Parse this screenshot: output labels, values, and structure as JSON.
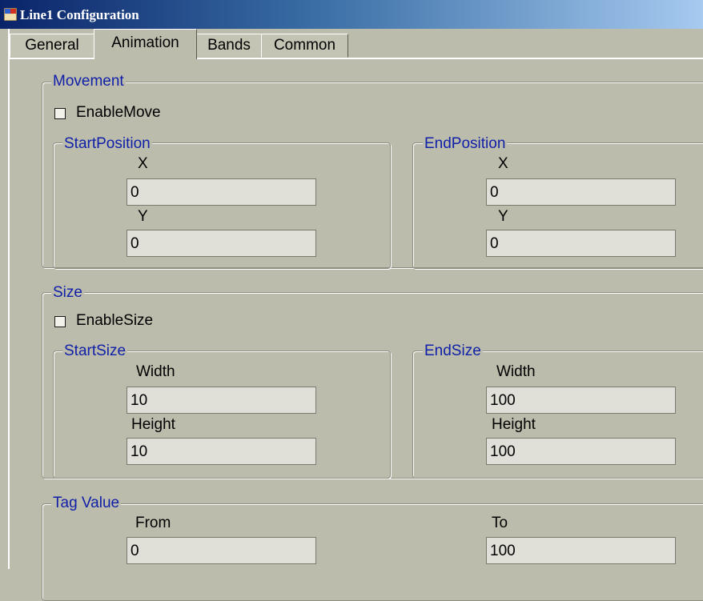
{
  "window": {
    "title": "Line1 Configuration"
  },
  "tabs": [
    {
      "label": "General"
    },
    {
      "label": "Animation"
    },
    {
      "label": "Bands"
    },
    {
      "label": "Common"
    }
  ],
  "movement": {
    "legend": "Movement",
    "enable_label": "EnableMove",
    "enabled": false,
    "start": {
      "legend": "StartPosition",
      "x_label": "X",
      "x_value": "0",
      "y_label": "Y",
      "y_value": "0"
    },
    "end": {
      "legend": "EndPosition",
      "x_label": "X",
      "x_value": "0",
      "y_label": "Y",
      "y_value": "0"
    }
  },
  "size": {
    "legend": "Size",
    "enable_label": "EnableSize",
    "enabled": false,
    "start": {
      "legend": "StartSize",
      "width_label": "Width",
      "width_value": "10",
      "height_label": "Height",
      "height_value": "10"
    },
    "end": {
      "legend": "EndSize",
      "width_label": "Width",
      "width_value": "100",
      "height_label": "Height",
      "height_value": "100"
    }
  },
  "tag_value": {
    "legend": "Tag Value",
    "from_label": "From",
    "from_value": "0",
    "to_label": "To",
    "to_value": "100"
  }
}
